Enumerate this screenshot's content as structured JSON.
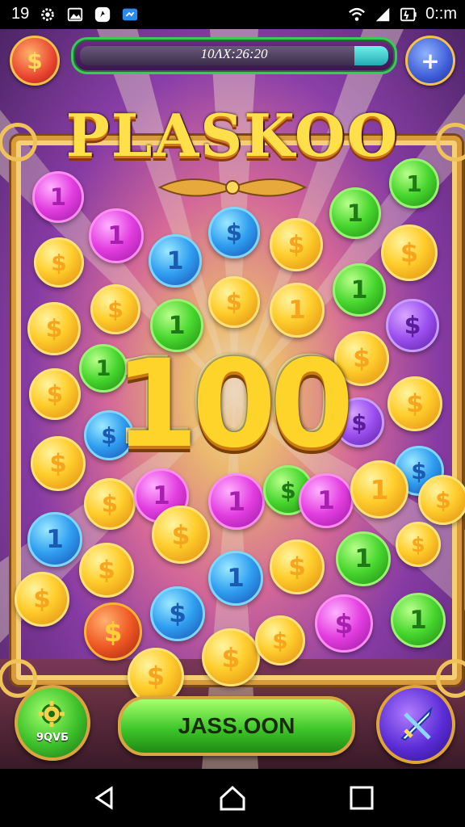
{
  "status_bar": {
    "left_text": "19",
    "time": "0::m",
    "icons": [
      "settings-gear-icon",
      "image-icon",
      "app-icon",
      "app-icon-2",
      "wifi-icon",
      "signal-icon",
      "battery-icon"
    ]
  },
  "hud": {
    "left_button_icon": "coin-icon",
    "left_button_glyph": "$",
    "progress_label": "10ɅX:26:20",
    "progress_fraction": 0.89,
    "right_button_icon": "plus-icon",
    "right_button_glyph": "+"
  },
  "title": "PLASKOO",
  "score": "100",
  "coin_glyphs": {
    "dollar": "$",
    "one": "1"
  },
  "bottom": {
    "left_button_label": "9QVБ",
    "left_button_icon": "gear-icon",
    "main_button_label": "JASS.OON",
    "right_button_icon": "sword-icon"
  },
  "nav": {
    "icons": [
      "back-icon",
      "home-icon",
      "recents-icon"
    ]
  },
  "colors": {
    "gold": "#ffce2d",
    "magenta": "#e33de0",
    "green": "#47d62e",
    "blue": "#2f9ef0",
    "purple": "#9b4ff0",
    "frame": "#d89a3a"
  }
}
